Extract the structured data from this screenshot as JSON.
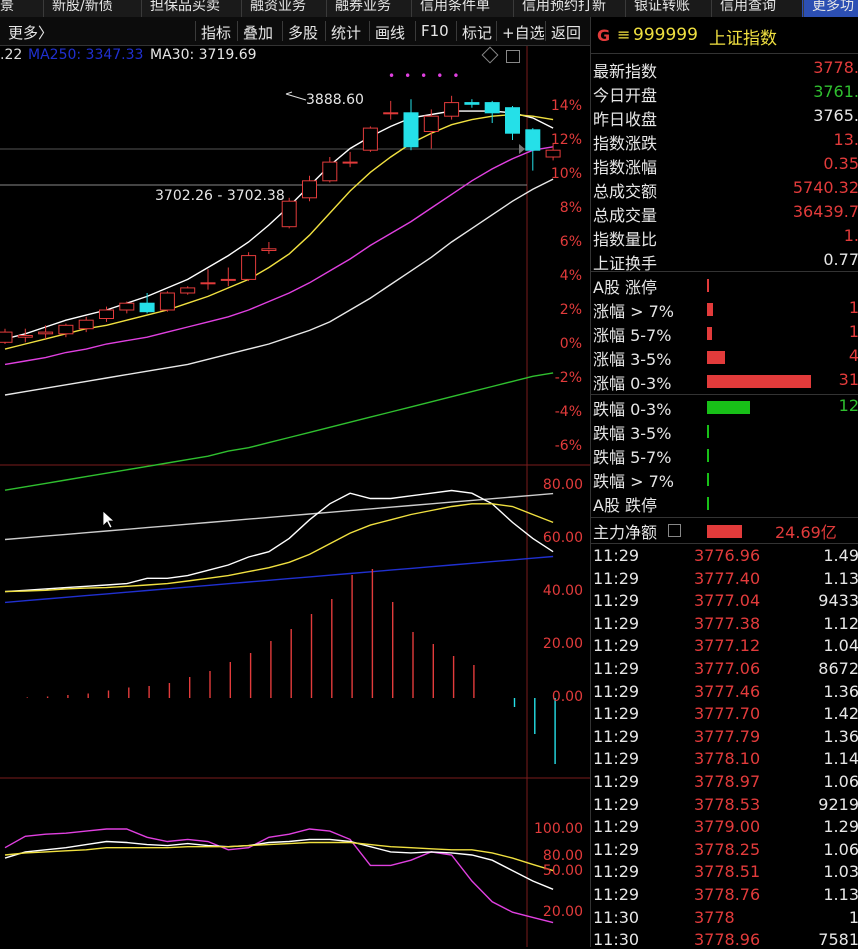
{
  "topbar": {
    "items": [
      "景",
      "新股/新债",
      "担保品买卖",
      "融资业务",
      "融券业务",
      "信用条件单",
      "信用预约打新",
      "银证转账",
      "信用查询",
      "更多功"
    ]
  },
  "toolbar": {
    "more": "更多〉",
    "buttons": [
      "指标",
      "叠加",
      "多股",
      "统计",
      "画线",
      "F10",
      "标记",
      "+自选",
      "返回"
    ]
  },
  "ma_legend": {
    "partial": ".22",
    "ma250": "MA250: 3347.33",
    "ma30": "MA30: 3719.69"
  },
  "chart_annotations": {
    "high": "3888.60",
    "range": "3702.26 - 3702.38"
  },
  "price_axis": [
    "14%",
    "12%",
    "10%",
    "8%",
    "6%",
    "4%",
    "2%",
    "0%",
    "-2%",
    "-4%",
    "-6%"
  ],
  "indicator1_axis": [
    "80.00",
    "60.00",
    "40.00",
    "20.00",
    "0.00"
  ],
  "indicator2_axis": [
    "100.00",
    "80.00",
    "50.00",
    "20.00"
  ],
  "right_panel": {
    "title_marker": "G",
    "title_menu": "≡",
    "code": "999999",
    "name": "上证指数",
    "stats": [
      {
        "label": "最新指数",
        "value": "3778.",
        "color": "#e23b3b"
      },
      {
        "label": "今日开盘",
        "value": "3761.",
        "color": "#2fbf2f"
      },
      {
        "label": "昨日收盘",
        "value": "3765.",
        "color": "#e6e6e6"
      },
      {
        "label": "指数涨跌",
        "value": "13.",
        "color": "#e23b3b"
      },
      {
        "label": "指数涨幅",
        "value": "0.35",
        "color": "#e23b3b"
      },
      {
        "label": "总成交额",
        "value": "5740.32",
        "color": "#e23b3b"
      },
      {
        "label": "总成交量",
        "value": "36439.7",
        "color": "#e23b3b"
      },
      {
        "label": "指数量比",
        "value": "1.",
        "color": "#e23b3b"
      },
      {
        "label": "上证换手",
        "value": "0.77",
        "color": "#e6e6e6"
      }
    ],
    "rise_dist": [
      {
        "label": "A股 涨停",
        "count": "",
        "ratio": 0.02
      },
      {
        "label": "涨幅 > 7%",
        "count": "1",
        "ratio": 0.06
      },
      {
        "label": "涨幅 5-7%",
        "count": "1",
        "ratio": 0.05
      },
      {
        "label": "涨幅 3-5%",
        "count": "4",
        "ratio": 0.17
      },
      {
        "label": "涨幅 0-3%",
        "count": "31",
        "ratio": 1.0
      }
    ],
    "fall_dist": [
      {
        "label": "跌幅 0-3%",
        "count": "12",
        "ratio": 0.41
      },
      {
        "label": "跌幅 3-5%",
        "count": "",
        "ratio": 0.01
      },
      {
        "label": "跌幅 5-7%",
        "count": "",
        "ratio": 0.01
      },
      {
        "label": "跌幅 > 7%",
        "count": "",
        "ratio": 0.01
      },
      {
        "label": "A股 跌停",
        "count": "",
        "ratio": 0.01
      }
    ],
    "main_flow": {
      "label": "主力净额",
      "value": "24.69亿",
      "ratio": 0.34
    },
    "ticks": [
      {
        "time": "11:29",
        "price": "3776.96",
        "vol": "1.49"
      },
      {
        "time": "11:29",
        "price": "3777.40",
        "vol": "1.13"
      },
      {
        "time": "11:29",
        "price": "3777.04",
        "vol": "9433"
      },
      {
        "time": "11:29",
        "price": "3777.38",
        "vol": "1.12"
      },
      {
        "time": "11:29",
        "price": "3777.12",
        "vol": "1.04"
      },
      {
        "time": "11:29",
        "price": "3777.06",
        "vol": "8672"
      },
      {
        "time": "11:29",
        "price": "3777.46",
        "vol": "1.36"
      },
      {
        "time": "11:29",
        "price": "3777.70",
        "vol": "1.42"
      },
      {
        "time": "11:29",
        "price": "3777.79",
        "vol": "1.36"
      },
      {
        "time": "11:29",
        "price": "3778.10",
        "vol": "1.14"
      },
      {
        "time": "11:29",
        "price": "3778.97",
        "vol": "1.06"
      },
      {
        "time": "11:29",
        "price": "3778.53",
        "vol": "9219"
      },
      {
        "time": "11:29",
        "price": "3779.00",
        "vol": "1.29"
      },
      {
        "time": "11:29",
        "price": "3778.25",
        "vol": "1.06"
      },
      {
        "time": "11:29",
        "price": "3778.51",
        "vol": "1.03"
      },
      {
        "time": "11:29",
        "price": "3778.76",
        "vol": "1.13"
      },
      {
        "time": "11:30",
        "price": "3778",
        "vol": "1"
      },
      {
        "time": "11:30",
        "price": "3778.96",
        "vol": "7581"
      }
    ]
  },
  "colors": {
    "up": "#e23b3b",
    "down": "#25e0e8",
    "ma_white": "#ffffff",
    "ma_yellow": "#f0e040",
    "ma_magenta": "#e040e0",
    "ma_green": "#2fbf2f",
    "ma_gray": "#cccccc",
    "ma_blue": "#2030d0"
  },
  "candles": [
    {
      "o": 0.1,
      "c": 0.7,
      "h": 0.9,
      "l": 0.0
    },
    {
      "o": 0.4,
      "c": 0.5,
      "h": 0.9,
      "l": 0.1
    },
    {
      "o": 0.6,
      "c": 0.7,
      "h": 1.1,
      "l": 0.3
    },
    {
      "o": 0.6,
      "c": 1.1,
      "h": 1.2,
      "l": 0.4
    },
    {
      "o": 0.9,
      "c": 1.4,
      "h": 1.6,
      "l": 0.7
    },
    {
      "o": 1.5,
      "c": 2.0,
      "h": 2.2,
      "l": 1.3
    },
    {
      "o": 2.0,
      "c": 2.4,
      "h": 2.5,
      "l": 1.8
    },
    {
      "o": 2.4,
      "c": 1.9,
      "h": 3.0,
      "l": 1.8
    },
    {
      "o": 2.0,
      "c": 3.0,
      "h": 3.1,
      "l": 1.9
    },
    {
      "o": 3.0,
      "c": 3.3,
      "h": 3.4,
      "l": 2.9
    },
    {
      "o": 3.6,
      "c": 3.6,
      "h": 4.4,
      "l": 3.2
    },
    {
      "o": 3.8,
      "c": 3.8,
      "h": 4.5,
      "l": 3.4
    },
    {
      "o": 3.8,
      "c": 5.2,
      "h": 5.4,
      "l": 3.7
    },
    {
      "o": 5.5,
      "c": 5.6,
      "h": 6.0,
      "l": 5.3
    },
    {
      "o": 6.9,
      "c": 8.4,
      "h": 8.6,
      "l": 6.8
    },
    {
      "o": 8.6,
      "c": 9.6,
      "h": 9.9,
      "l": 8.4
    },
    {
      "o": 9.6,
      "c": 10.7,
      "h": 11.0,
      "l": 9.5
    },
    {
      "o": 10.7,
      "c": 10.7,
      "h": 11.3,
      "l": 10.4
    },
    {
      "o": 11.4,
      "c": 12.7,
      "h": 12.8,
      "l": 11.3
    },
    {
      "o": 13.6,
      "c": 13.6,
      "h": 14.3,
      "l": 13.2
    },
    {
      "o": 13.6,
      "c": 11.6,
      "h": 14.4,
      "l": 11.4
    },
    {
      "o": 12.5,
      "c": 13.4,
      "h": 13.8,
      "l": 11.5
    },
    {
      "o": 13.4,
      "c": 14.2,
      "h": 14.6,
      "l": 13.2
    },
    {
      "o": 14.2,
      "c": 14.1,
      "h": 14.4,
      "l": 13.9
    },
    {
      "o": 14.2,
      "c": 13.6,
      "h": 14.3,
      "l": 13.0
    },
    {
      "o": 13.9,
      "c": 12.4,
      "h": 14.0,
      "l": 12.0
    },
    {
      "o": 12.6,
      "c": 11.4,
      "h": 12.7,
      "l": 10.2
    },
    {
      "o": 11.0,
      "c": 11.4,
      "h": 11.8,
      "l": 10.8
    }
  ],
  "ma_lines": {
    "white": [
      0.3,
      0.6,
      1.0,
      1.4,
      1.7,
      2.0,
      2.4,
      2.8,
      3.3,
      3.8,
      4.5,
      5.2,
      6.0,
      7.0,
      8.1,
      9.3,
      10.5,
      11.5,
      12.2,
      12.8,
      13.3,
      13.5,
      13.7,
      13.7,
      13.7,
      13.6,
      13.3,
      12.7
    ],
    "yellow": [
      -0.3,
      0.0,
      0.3,
      0.6,
      0.9,
      1.1,
      1.4,
      1.7,
      2.0,
      2.4,
      2.8,
      3.3,
      3.8,
      4.5,
      5.3,
      6.4,
      7.7,
      9.0,
      10.1,
      11.0,
      11.8,
      12.4,
      12.9,
      13.2,
      13.4,
      13.5,
      13.4,
      13.2
    ],
    "magenta": [
      -1.2,
      -1.0,
      -0.8,
      -0.5,
      -0.3,
      0.0,
      0.2,
      0.4,
      0.7,
      1.0,
      1.3,
      1.6,
      2.0,
      2.5,
      3.0,
      3.6,
      4.3,
      5.0,
      5.8,
      6.5,
      7.2,
      8.0,
      8.8,
      9.6,
      10.3,
      10.9,
      11.4,
      11.6
    ],
    "lightwhite": [
      -3.0,
      -2.8,
      -2.6,
      -2.4,
      -2.2,
      -2.0,
      -1.8,
      -1.6,
      -1.4,
      -1.2,
      -0.9,
      -0.6,
      -0.3,
      0.0,
      0.4,
      0.8,
      1.3,
      2.0,
      2.7,
      3.5,
      4.3,
      5.1,
      6.0,
      6.8,
      7.6,
      8.4,
      9.1,
      9.7
    ],
    "green": [
      -8.6,
      -8.4,
      -8.2,
      -8.0,
      -7.8,
      -7.6,
      -7.4,
      -7.2,
      -7.0,
      -6.8,
      -6.6,
      -6.3,
      -6.1,
      -5.8,
      -5.5,
      -5.2,
      -4.9,
      -4.6,
      -4.3,
      -4.0,
      -3.7,
      -3.4,
      -3.1,
      -2.8,
      -2.5,
      -2.2,
      -1.9,
      -1.7
    ],
    "gray": [
      -11.5,
      -11.4,
      -11.3,
      -11.2,
      -11.1,
      -11.0,
      -10.9,
      -10.8,
      -10.7,
      -10.6,
      -10.5,
      -10.4,
      -10.3,
      -10.2,
      -10.1,
      -10.0,
      -9.9,
      -9.8,
      -9.7,
      -9.6,
      -9.5,
      -9.4,
      -9.3,
      -9.2,
      -9.1,
      -9.0,
      -8.9,
      -8.8
    ],
    "blue": [
      -15.2,
      -15.1,
      -15.0,
      -14.9,
      -14.8,
      -14.7,
      -14.6,
      -14.5,
      -14.4,
      -14.3,
      -14.2,
      -14.1,
      -14.0,
      -13.9,
      -13.8,
      -13.7,
      -13.6,
      -13.5,
      -13.4,
      -13.3,
      -13.2,
      -13.1,
      -13.0,
      -12.9,
      -12.8,
      -12.7,
      -12.6,
      -12.5
    ]
  },
  "macd_lines": {
    "white": [
      40,
      40.5,
      41,
      41.5,
      42,
      42.5,
      43,
      45,
      45,
      46,
      48,
      50,
      53,
      55,
      60,
      67,
      73,
      77,
      75,
      75,
      76,
      77,
      78,
      77,
      73,
      66,
      60,
      55
    ],
    "yellow": [
      40,
      40.2,
      40.5,
      41,
      41.3,
      41.5,
      42,
      42.5,
      43,
      44,
      45,
      46,
      47.5,
      49,
      51,
      54,
      58,
      62,
      65,
      67,
      69,
      70.5,
      72,
      73,
      73,
      72,
      69,
      66
    ]
  },
  "macd_bars": [
    0,
    0.2,
    0.5,
    1,
    1.5,
    2.5,
    3.5,
    4,
    5,
    7,
    9,
    12,
    15,
    19,
    23,
    28,
    33,
    41,
    43,
    32,
    22,
    18,
    14,
    11,
    0,
    -3,
    -12,
    -22
  ],
  "kdj_lines": {
    "magenta": [
      82,
      93,
      95,
      96,
      98,
      100,
      100,
      92,
      88,
      90,
      88,
      80,
      82,
      92,
      95,
      100,
      98,
      90,
      65,
      65,
      70,
      78,
      75,
      50,
      30,
      20,
      15,
      10
    ],
    "white": [
      72,
      78,
      80,
      82,
      85,
      88,
      87,
      85,
      84,
      86,
      84,
      83,
      84,
      87,
      88,
      90,
      90,
      88,
      83,
      78,
      77,
      78,
      77,
      75,
      70,
      60,
      50,
      42
    ],
    "yellow": [
      75,
      77,
      78,
      79,
      80,
      82,
      82,
      82,
      82,
      83,
      83,
      83,
      84,
      85,
      86,
      87,
      87,
      87,
      85,
      83,
      82,
      81,
      80,
      80,
      77,
      72,
      66,
      60
    ]
  }
}
